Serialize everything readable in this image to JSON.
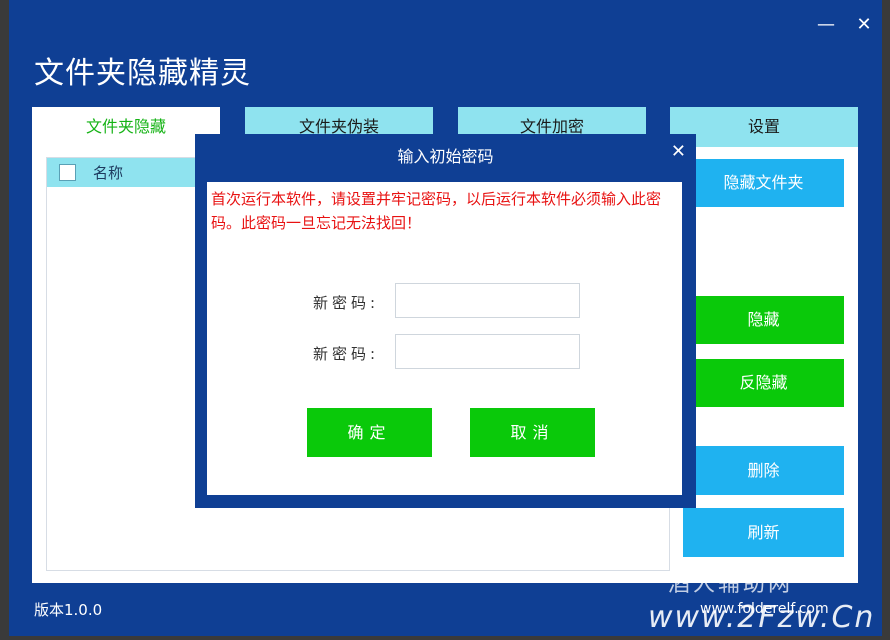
{
  "window": {
    "title": "文件夹隐藏精灵",
    "minimize_glyph": "—",
    "close_glyph": "✕",
    "version": "版本1.0.0"
  },
  "tabs": [
    {
      "label": "文件夹隐藏",
      "active": true
    },
    {
      "label": "文件夹伪装",
      "active": false
    },
    {
      "label": "文件加密",
      "active": false
    },
    {
      "label": "设置",
      "active": false
    }
  ],
  "list": {
    "column_name": "名称"
  },
  "side_buttons": {
    "hide_folder": "隐藏文件夹",
    "hide": "隐藏",
    "unhide": "反隐藏",
    "delete": "删除",
    "refresh": "刷新"
  },
  "dialog": {
    "title": "输入初始密码",
    "close_glyph": "✕",
    "warning": "首次运行本软件，请设置并牢记密码，以后运行本软件必须输入此密码。此密码一旦忘记无法找回！",
    "new_password_label_1": "新密码:",
    "new_password_label_2": "新密码:",
    "new_password_value_1": "",
    "new_password_value_2": "",
    "ok_label": "确定",
    "cancel_label": "取消"
  },
  "watermark": {
    "line1": "酒人辅助网",
    "line2": "www.folderelf.com",
    "line3": "www.2Fzw.Cn"
  },
  "colors": {
    "window_bg": "#0f3f94",
    "tab_bg": "#8fe3ef",
    "active_tab_text": "#16b316",
    "button_blue": "#1fb2f0",
    "button_green": "#0ac90a",
    "warning_text": "#e81212"
  }
}
